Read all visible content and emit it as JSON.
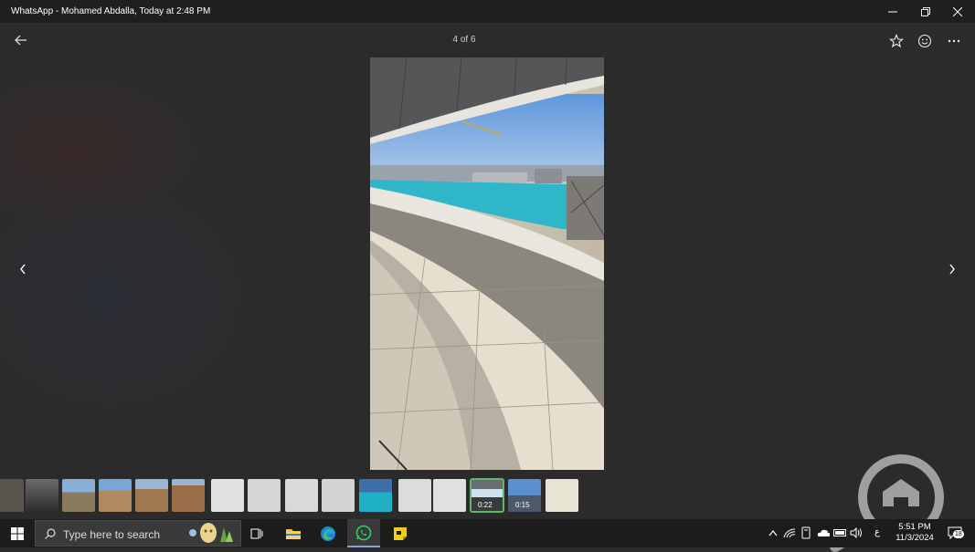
{
  "window": {
    "title": "WhatsApp - Mohamed Abdalla, Today at 2:48 PM",
    "controls": [
      "minimize-icon",
      "restore-icon",
      "close-icon"
    ]
  },
  "viewer": {
    "counter": "4 of 6",
    "toolbar_icons": [
      "star-icon",
      "emoji-icon",
      "more-icon"
    ],
    "photo_description_icon": "balcony-photo"
  },
  "thumbnails": [
    {
      "kind": "photo",
      "duration": ""
    },
    {
      "kind": "photo",
      "duration": ""
    },
    {
      "kind": "photo",
      "duration": ""
    },
    {
      "kind": "photo",
      "duration": ""
    },
    {
      "kind": "photo",
      "duration": ""
    },
    {
      "kind": "photo",
      "duration": ""
    },
    {
      "kind": "document",
      "duration": ""
    },
    {
      "kind": "document",
      "duration": ""
    },
    {
      "kind": "document",
      "duration": ""
    },
    {
      "kind": "document",
      "duration": ""
    },
    {
      "kind": "photo",
      "duration": ""
    },
    {
      "kind": "document",
      "duration": ""
    },
    {
      "kind": "document",
      "duration": ""
    },
    {
      "kind": "video",
      "duration": "0:22",
      "selected": true
    },
    {
      "kind": "video",
      "duration": "0:15"
    },
    {
      "kind": "document",
      "duration": ""
    }
  ],
  "taskbar": {
    "search_placeholder": "Type here to search",
    "pinned": [
      "task-view-icon",
      "file-explorer-icon",
      "edge-icon",
      "whatsapp-icon",
      "sticky-notes-icon"
    ],
    "tray": [
      "chevron-up-icon",
      "wifi-icon",
      "device-icon",
      "cloud-icon",
      "battery-icon",
      "volume-icon"
    ],
    "language": "ع",
    "time": "5:51 PM",
    "date": "11/3/2024",
    "notifications": "18"
  },
  "colors": {
    "accent_selected": "#5fb86a",
    "whatsapp": "#25d366",
    "viewer_bg": "#2b2b2b",
    "taskbar_bg": "#1c1c1c"
  }
}
